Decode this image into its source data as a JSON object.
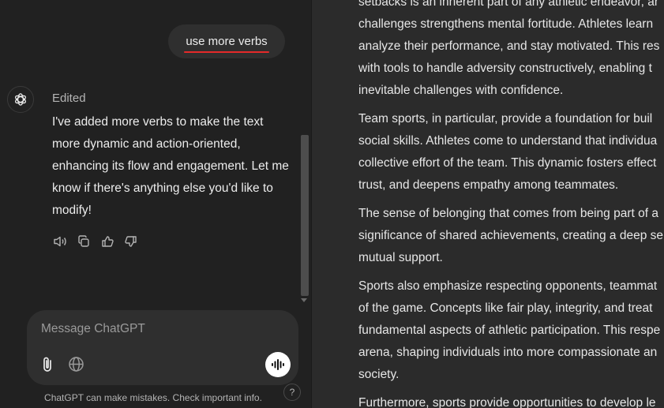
{
  "chat": {
    "user_message": "use more verbs",
    "assistant": {
      "status": "Edited",
      "message": "I've added more verbs to make the text more dynamic and action-oriented, enhancing its flow and engagement. Let me know if there's anything else you'd like to modify!"
    },
    "actions": [
      "read-aloud-icon",
      "copy-icon",
      "thumbs-up-icon",
      "thumbs-down-icon"
    ]
  },
  "composer": {
    "placeholder": "Message ChatGPT",
    "disclaimer": "ChatGPT can make mistakes. Check important info.",
    "help_label": "?"
  },
  "document": {
    "paragraphs": [
      "setbacks is an inherent part of any athletic endeavor, ar\nchallenges strengthens mental fortitude. Athletes learn\nanalyze their performance, and stay motivated. This res\nwith tools to handle adversity constructively, enabling t\ninevitable challenges with confidence.",
      "Team sports, in particular, provide a foundation for buil\nsocial skills. Athletes come to understand that individua\ncollective effort of the team. This dynamic fosters effect\ntrust, and deepens empathy among teammates.",
      "The sense of belonging that comes from being part of a\nsignificance of shared achievements, creating a deep se\nmutual support.",
      "Sports also emphasize respecting opponents, teammat\nof the game. Concepts like fair play, integrity, and treat\nfundamental aspects of athletic participation. This respe\narena, shaping individuals into more compassionate an\nsociety.",
      "Furthermore, sports provide opportunities to develop le"
    ]
  },
  "colors": {
    "background": "#212121",
    "document_background": "#2b2b2b",
    "bubble": "#2f2f2f",
    "underline": "#e52a2a"
  }
}
